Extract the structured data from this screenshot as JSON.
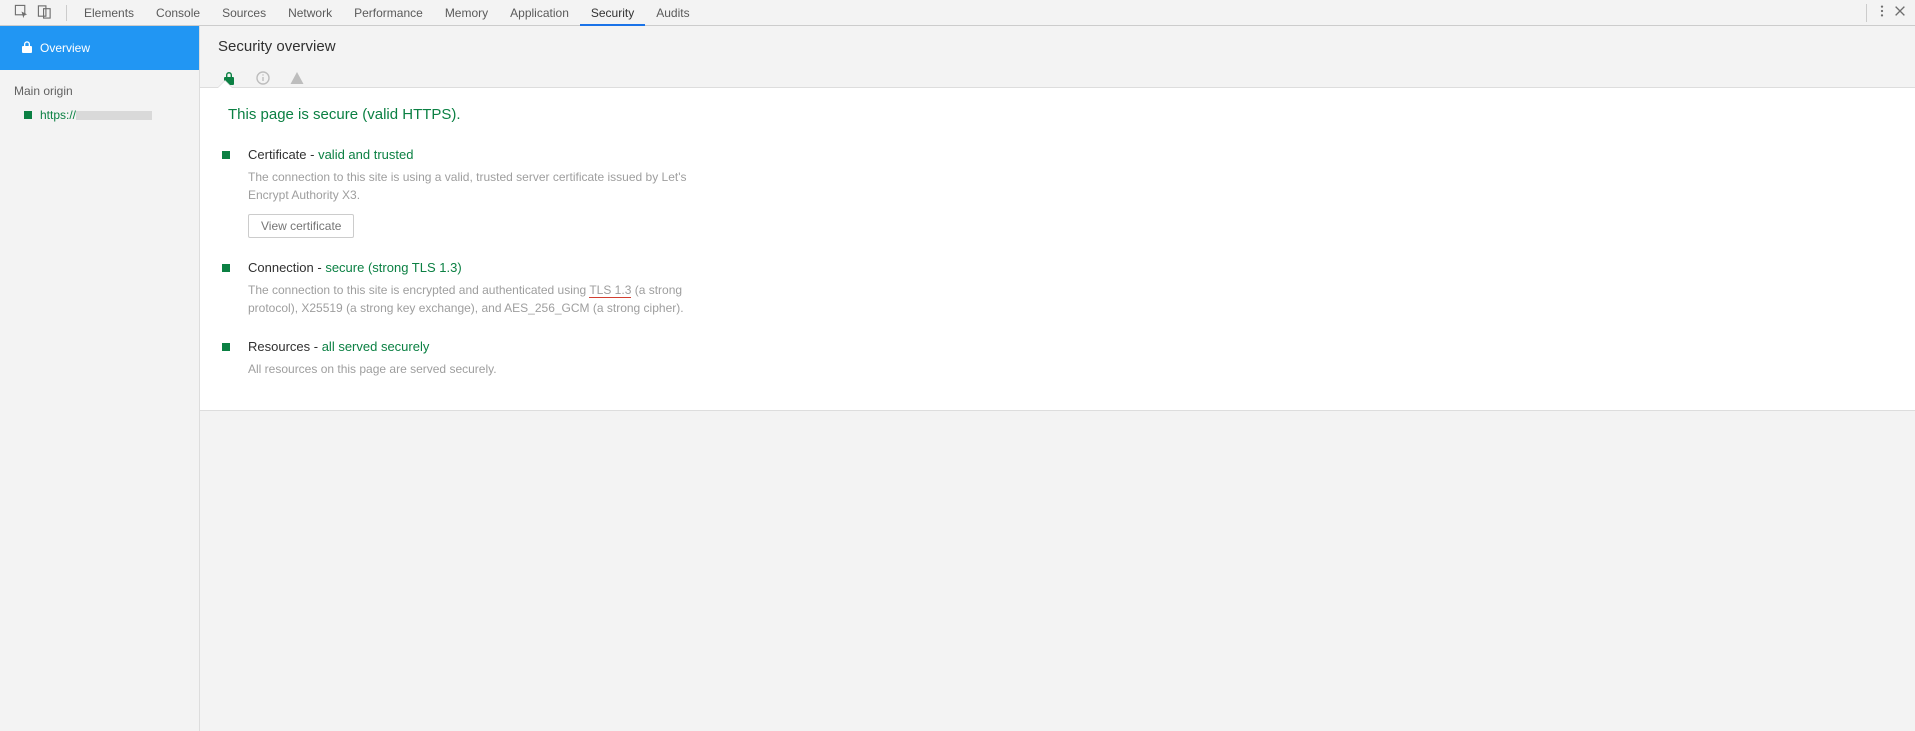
{
  "tabs": [
    "Elements",
    "Console",
    "Sources",
    "Network",
    "Performance",
    "Memory",
    "Application",
    "Security",
    "Audits"
  ],
  "activeTab": "Security",
  "sidebar": {
    "overview": "Overview",
    "mainOriginHeader": "Main origin",
    "originPrefix": "https://"
  },
  "header": {
    "title": "Security overview"
  },
  "secureHeadline": "This page is secure (valid HTTPS).",
  "sections": {
    "certificate": {
      "titlePrefix": "Certificate - ",
      "titleStatus": "valid and trusted",
      "desc": "The connection to this site is using a valid, trusted server certificate issued by Let's Encrypt Authority X3.",
      "button": "View certificate"
    },
    "connection": {
      "titlePrefix": "Connection - ",
      "titleStatusA": "secure (strong ",
      "titleStatusB": "TLS 1.3",
      "titleStatusC": ")",
      "descA": "The connection to this site is encrypted and authenticated using ",
      "descB": "TLS 1.3",
      "descC": " (a strong protocol), X25519 (a strong key exchange), and AES_256_GCM (a strong cipher)."
    },
    "resources": {
      "titlePrefix": "Resources - ",
      "titleStatus": "all served securely",
      "desc": "All resources on this page are served securely."
    }
  }
}
